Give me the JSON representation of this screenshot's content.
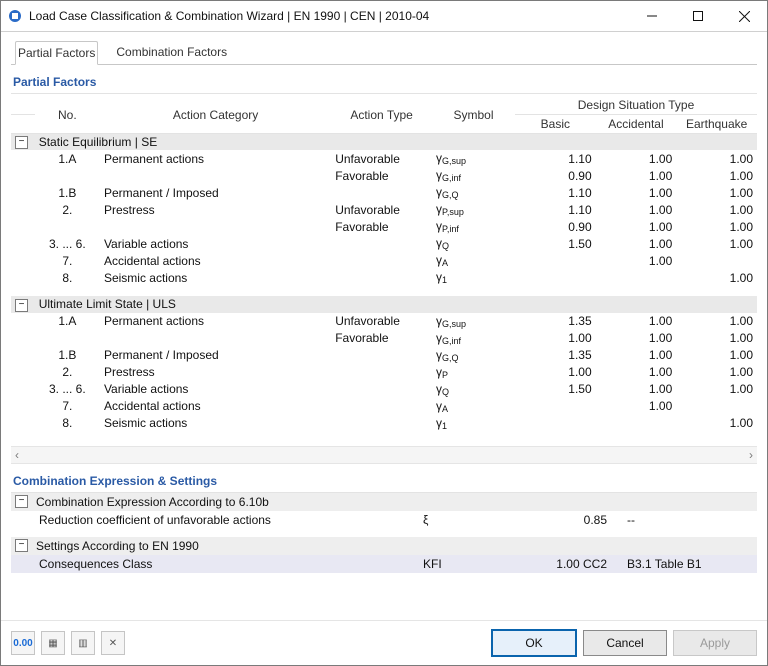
{
  "window": {
    "title": "Load Case Classification & Combination Wizard | EN 1990 | CEN | 2010-04"
  },
  "tabs": {
    "partial": "Partial Factors",
    "combination": "Combination Factors"
  },
  "section_pf": "Partial Factors",
  "headers": {
    "no": "No.",
    "action_cat": "Action Category",
    "action_type": "Action Type",
    "symbol": "Symbol",
    "dst": "Design Situation Type",
    "basic": "Basic",
    "accidental": "Accidental",
    "earthquake": "Earthquake"
  },
  "groups": [
    {
      "title": "Static Equilibrium | SE",
      "rows": [
        {
          "no": "1.A",
          "cat": "Permanent actions",
          "type": "Unfavorable",
          "sym": "γG,sup",
          "b": "1.10",
          "a": "1.00",
          "e": "1.00"
        },
        {
          "no": "",
          "cat": "",
          "type": "Favorable",
          "sym": "γG,inf",
          "b": "0.90",
          "a": "1.00",
          "e": "1.00"
        },
        {
          "no": "1.B",
          "cat": "Permanent / Imposed",
          "type": "",
          "sym": "γG,Q",
          "b": "1.10",
          "a": "1.00",
          "e": "1.00"
        },
        {
          "no": "2.",
          "cat": "Prestress",
          "type": "Unfavorable",
          "sym": "γP,sup",
          "b": "1.10",
          "a": "1.00",
          "e": "1.00"
        },
        {
          "no": "",
          "cat": "",
          "type": "Favorable",
          "sym": "γP,inf",
          "b": "0.90",
          "a": "1.00",
          "e": "1.00"
        },
        {
          "no": "3. ... 6.",
          "cat": "Variable actions",
          "type": "",
          "sym": "γQ",
          "b": "1.50",
          "a": "1.00",
          "e": "1.00"
        },
        {
          "no": "7.",
          "cat": "Accidental actions",
          "type": "",
          "sym": "γA",
          "b": "",
          "a": "1.00",
          "e": ""
        },
        {
          "no": "8.",
          "cat": "Seismic actions",
          "type": "",
          "sym": "γ1",
          "b": "",
          "a": "",
          "e": "1.00"
        }
      ]
    },
    {
      "title": "Ultimate Limit State | ULS",
      "rows": [
        {
          "no": "1.A",
          "cat": "Permanent actions",
          "type": "Unfavorable",
          "sym": "γG,sup",
          "b": "1.35",
          "a": "1.00",
          "e": "1.00"
        },
        {
          "no": "",
          "cat": "",
          "type": "Favorable",
          "sym": "γG,inf",
          "b": "1.00",
          "a": "1.00",
          "e": "1.00"
        },
        {
          "no": "1.B",
          "cat": "Permanent / Imposed",
          "type": "",
          "sym": "γG,Q",
          "b": "1.35",
          "a": "1.00",
          "e": "1.00"
        },
        {
          "no": "2.",
          "cat": "Prestress",
          "type": "",
          "sym": "γP",
          "b": "1.00",
          "a": "1.00",
          "e": "1.00"
        },
        {
          "no": "3. ... 6.",
          "cat": "Variable actions",
          "type": "",
          "sym": "γQ",
          "b": "1.50",
          "a": "1.00",
          "e": "1.00"
        },
        {
          "no": "7.",
          "cat": "Accidental actions",
          "type": "",
          "sym": "γA",
          "b": "",
          "a": "1.00",
          "e": ""
        },
        {
          "no": "8.",
          "cat": "Seismic actions",
          "type": "",
          "sym": "γ1",
          "b": "",
          "a": "",
          "e": "1.00"
        }
      ]
    }
  ],
  "section_ces": "Combination Expression & Settings",
  "ces_group1": "Combination Expression According to 6.10b",
  "ces_row1_label": "Reduction coefficient of unfavorable actions",
  "ces_row1_sym": "ξ",
  "ces_row1_val": "0.85",
  "ces_row1_desc": "--",
  "ces_group2": "Settings According to EN 1990",
  "ces_row2_label": "Consequences Class",
  "ces_row2_sym": "KFI",
  "ces_row2_val": "1.00 CC2",
  "ces_row2_desc": "B3.1 Table B1",
  "footer": {
    "ok": "OK",
    "cancel": "Cancel",
    "apply": "Apply"
  },
  "toolbar_icons": {
    "i1": "0.00",
    "i2": "▦",
    "i3": "▥",
    "i4": "✕"
  }
}
